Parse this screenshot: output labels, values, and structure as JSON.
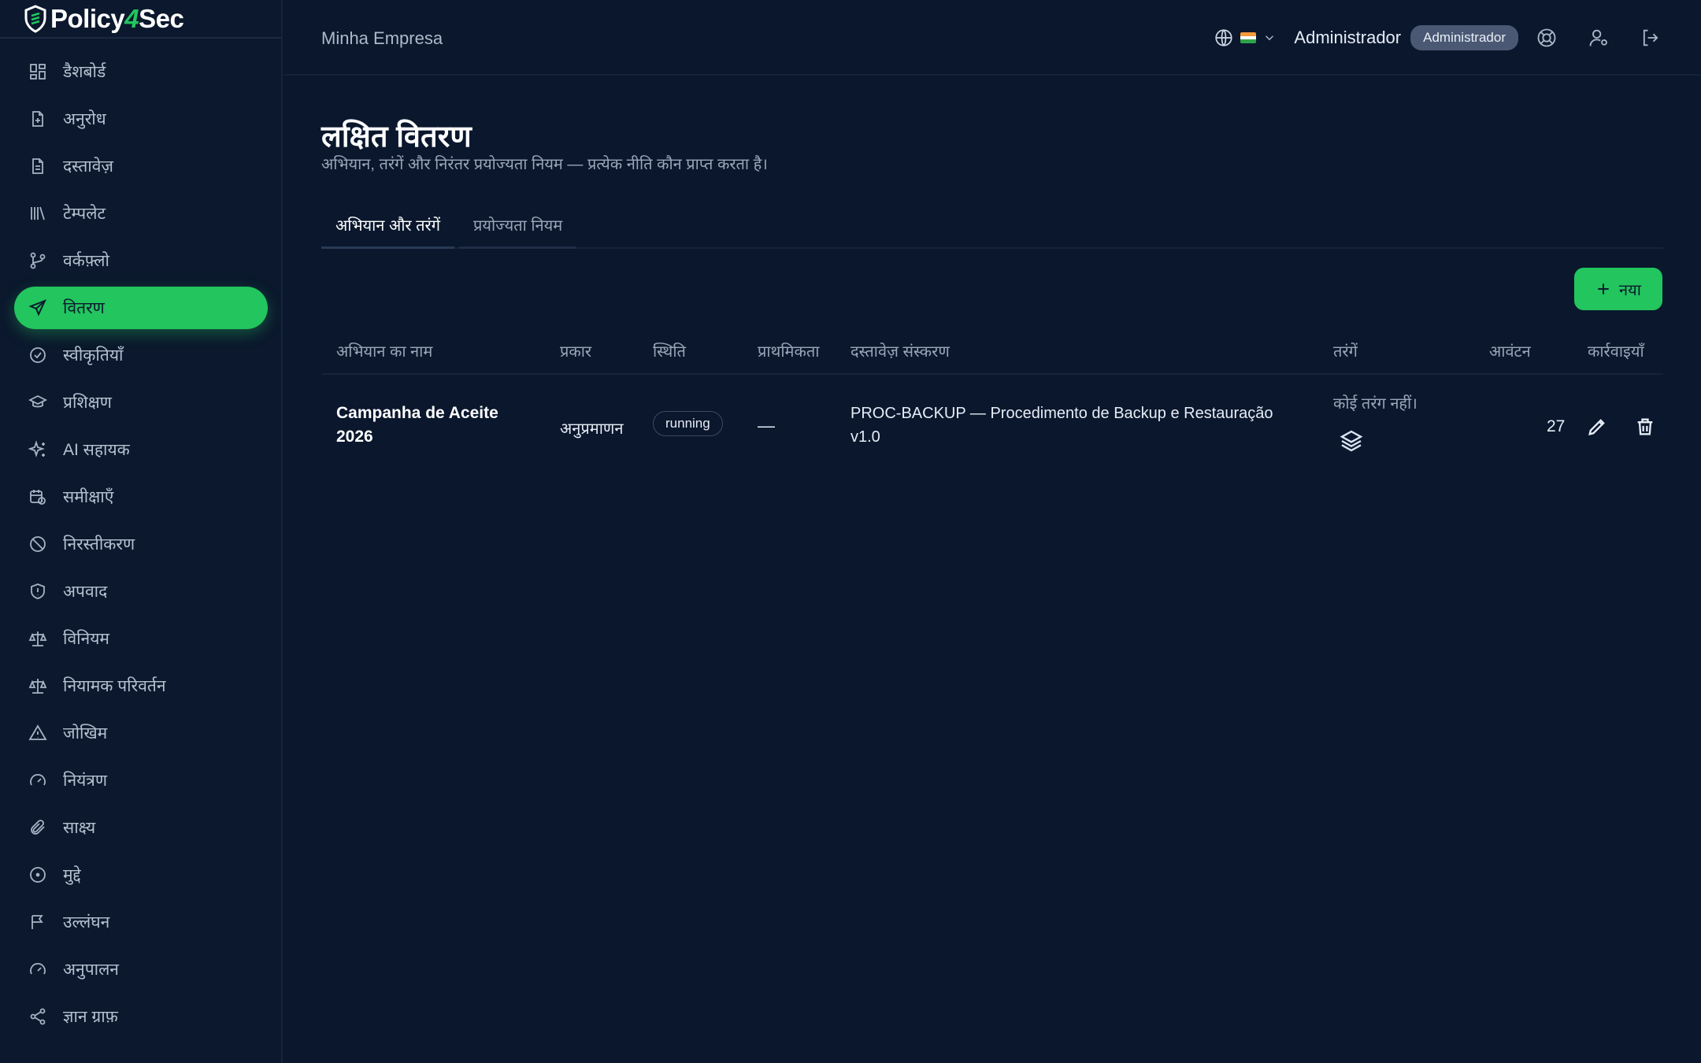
{
  "brand": {
    "name_prefix": "Policy",
    "name_mid": "4",
    "name_suffix": "Sec"
  },
  "sidebar": {
    "items": [
      {
        "label": "डैशबोर्ड",
        "icon": "dashboard-icon"
      },
      {
        "label": "अनुरोध",
        "icon": "file-plus-icon"
      },
      {
        "label": "दस्तावेज़",
        "icon": "document-icon"
      },
      {
        "label": "टेम्पलेट",
        "icon": "library-icon"
      },
      {
        "label": "वर्कफ़्लो",
        "icon": "git-branch-icon"
      },
      {
        "label": "वितरण",
        "icon": "send-icon",
        "active": true
      },
      {
        "label": "स्वीकृतियाँ",
        "icon": "check-circle-icon"
      },
      {
        "label": "प्रशिक्षण",
        "icon": "graduation-cap-icon"
      },
      {
        "label": "AI सहायक",
        "icon": "sparkles-icon"
      },
      {
        "label": "समीक्षाएँ",
        "icon": "calendar-clock-icon"
      },
      {
        "label": "निरस्तीकरण",
        "icon": "ban-icon"
      },
      {
        "label": "अपवाद",
        "icon": "shield-alert-icon"
      },
      {
        "label": "विनियम",
        "icon": "scale-icon"
      },
      {
        "label": "नियामक परिवर्तन",
        "icon": "scale-icon"
      },
      {
        "label": "जोखिम",
        "icon": "alert-triangle-icon"
      },
      {
        "label": "नियंत्रण",
        "icon": "gauge-icon"
      },
      {
        "label": "साक्ष्य",
        "icon": "paperclip-icon"
      },
      {
        "label": "मुद्दे",
        "icon": "circle-dot-icon"
      },
      {
        "label": "उल्लंघन",
        "icon": "flag-icon"
      },
      {
        "label": "अनुपालन",
        "icon": "gauge-icon"
      },
      {
        "label": "ज्ञान ग्राफ़",
        "icon": "share-icon"
      }
    ]
  },
  "header": {
    "company": "Minha Empresa",
    "user_name": "Administrador",
    "role_badge": "Administrador"
  },
  "page": {
    "title": "लक्षित वितरण",
    "subtitle": "अभियान, तरंगें और निरंतर प्रयोज्यता नियम — प्रत्येक नीति कौन प्राप्त करता है।",
    "tabs": [
      {
        "label": "अभियान और तरंगें",
        "active": true
      },
      {
        "label": "प्रयोज्यता नियम",
        "active": false
      }
    ],
    "new_button": "नया"
  },
  "table": {
    "headers": {
      "name": "अभियान का नाम",
      "type": "प्रकार",
      "status": "स्थिति",
      "priority": "प्राथमिकता",
      "doc_version": "दस्तावेज़ संस्करण",
      "waves": "तरंगें",
      "allocation": "आवंटन",
      "actions": "कार्रवाइयाँ"
    },
    "rows": [
      {
        "name": "Campanha de Aceite 2026",
        "type": "अनुप्रमाणन",
        "status": "running",
        "priority": "—",
        "doc_version": "PROC-BACKUP — Procedimento de Backup e Restauração v1.0",
        "waves": "कोई तरंग नहीं।",
        "allocation": "27"
      }
    ]
  },
  "colors": {
    "background": "#0a172d",
    "accent": "#22c55e",
    "badge": "#4a5873"
  }
}
